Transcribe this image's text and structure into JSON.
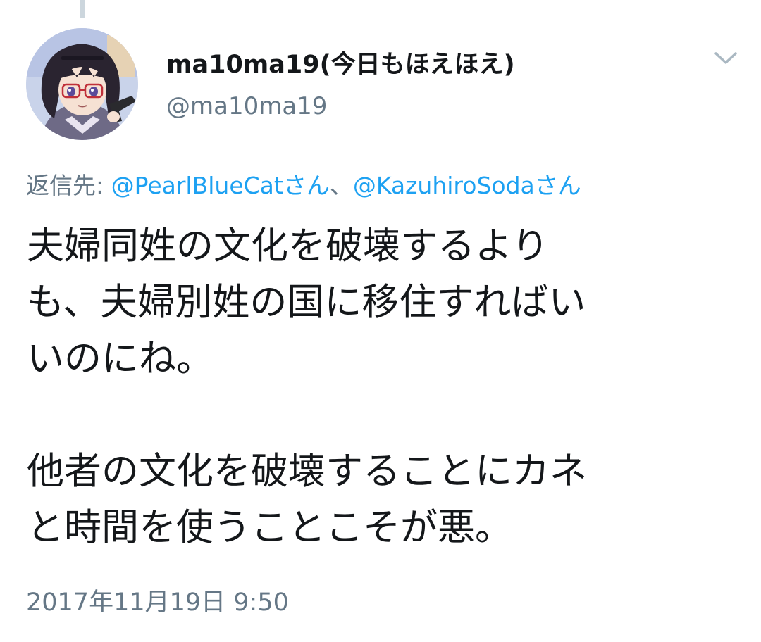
{
  "tweet": {
    "display_name": "ma10ma19(今日もほえほえ)",
    "handle": "@ma10ma19",
    "reply_prefix": "返信先: ",
    "reply_to": [
      {
        "mention": "@PearlBlueCatさん"
      },
      {
        "mention": "@KazuhiroSodaさん"
      }
    ],
    "reply_separator": "、",
    "paragraphs": [
      "夫婦同姓の文化を破壊するより\nも、夫婦別姓の国に移住すればい\nいのにね。",
      "他者の文化を破壊することにカネ\nと時間を使うことこそが悪。"
    ],
    "timestamp": "2017年11月19日 9:50"
  },
  "icons": {
    "menu": "chevron-down-icon",
    "avatar": "avatar"
  },
  "colors": {
    "link": "#1da1f2",
    "secondary_text": "#657786",
    "primary_text": "#14171a",
    "thread_line": "#ccd6dd"
  }
}
